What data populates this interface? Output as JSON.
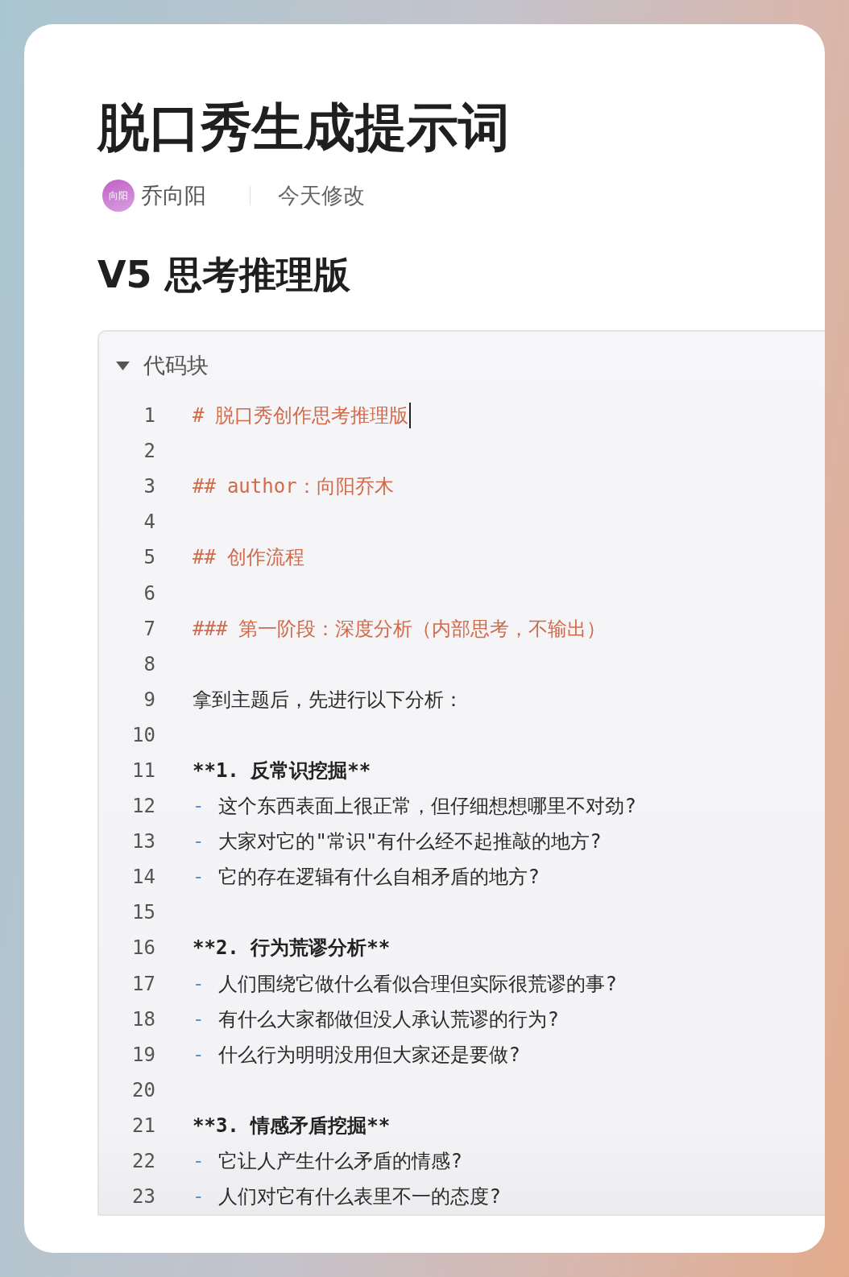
{
  "title": "脱口秀生成提示词",
  "meta": {
    "avatar_text": "向阳",
    "author": "乔向阳",
    "modified": "今天修改"
  },
  "section_heading": "V5 思考推理版",
  "code_block": {
    "label": "代码块",
    "expanded": true,
    "lines": [
      {
        "number": "1",
        "kind": "heading",
        "marker": "#",
        "text": "脱口秀创作思考推理版",
        "cursor": true
      },
      {
        "number": "2",
        "kind": "empty"
      },
      {
        "number": "3",
        "kind": "heading",
        "marker": "##",
        "text": "author：向阳乔木"
      },
      {
        "number": "4",
        "kind": "empty"
      },
      {
        "number": "5",
        "kind": "heading",
        "marker": "##",
        "text": "创作流程"
      },
      {
        "number": "6",
        "kind": "empty"
      },
      {
        "number": "7",
        "kind": "heading",
        "marker": "###",
        "text": "第一阶段：深度分析（内部思考，不输出）"
      },
      {
        "number": "8",
        "kind": "empty"
      },
      {
        "number": "9",
        "kind": "text",
        "text": "拿到主题后，先进行以下分析："
      },
      {
        "number": "10",
        "kind": "empty"
      },
      {
        "number": "11",
        "kind": "bold",
        "text": "**1. 反常识挖掘**"
      },
      {
        "number": "12",
        "kind": "bullet",
        "marker": "-",
        "text": "这个东西表面上很正常，但仔细想想哪里不对劲?"
      },
      {
        "number": "13",
        "kind": "bullet",
        "marker": "-",
        "text": "大家对它的\"常识\"有什么经不起推敲的地方?"
      },
      {
        "number": "14",
        "kind": "bullet",
        "marker": "-",
        "text": "它的存在逻辑有什么自相矛盾的地方?"
      },
      {
        "number": "15",
        "kind": "empty"
      },
      {
        "number": "16",
        "kind": "bold",
        "text": "**2. 行为荒谬分析**"
      },
      {
        "number": "17",
        "kind": "bullet",
        "marker": "-",
        "text": "人们围绕它做什么看似合理但实际很荒谬的事?"
      },
      {
        "number": "18",
        "kind": "bullet",
        "marker": "-",
        "text": "有什么大家都做但没人承认荒谬的行为?"
      },
      {
        "number": "19",
        "kind": "bullet",
        "marker": "-",
        "text": "什么行为明明没用但大家还是要做?"
      },
      {
        "number": "20",
        "kind": "empty"
      },
      {
        "number": "21",
        "kind": "bold",
        "text": "**3. 情感矛盾挖掘**"
      },
      {
        "number": "22",
        "kind": "bullet",
        "marker": "-",
        "text": "它让人产生什么矛盾的情感?"
      },
      {
        "number": "23",
        "kind": "bullet",
        "marker": "-",
        "text": "人们对它有什么表里不一的态度?"
      }
    ]
  }
}
